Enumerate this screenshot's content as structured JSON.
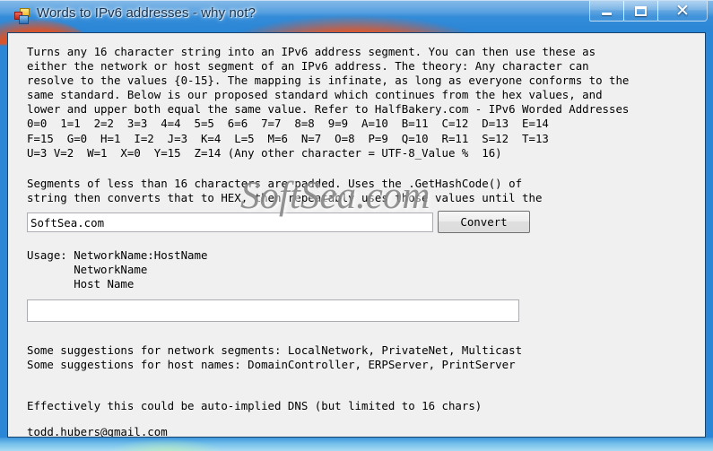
{
  "window": {
    "title": "Words to IPv6 addresses - why not?",
    "icon": "app-squares-icon",
    "controls": {
      "minimize": "Minimize",
      "maximize": "Maximize",
      "close": "Close"
    },
    "titlebar_color": "#2a86d6",
    "client_background": "#f0f0f0"
  },
  "body": {
    "intro_paragraph": "Turns any 16 character string into an IPv6 address segment. You can then use these as\neither the network or host segment of an IPv6 address. The theory: Any character can\nresolve to the values {0-15}. The mapping is infinate, as long as everyone conforms to the\nsame standard. Below is our proposed standard which continues from the hex values, and\nlower and upper both equal the same value. Refer to HalfBakery.com - IPv6 Worded Addresses\n0=0  1=1  2=2  3=3  4=4  5=5  6=6  7=7  8=8  9=9  A=10  B=11  C=12  D=13  E=14\nF=15  G=0  H=1  I=2  J=3  K=4  L=5  M=6  N=7  O=8  P=9  Q=10  R=11  S=12  T=13\nU=3 V=2  W=1  X=0  Y=15  Z=14 (Any other character = UTF-8_Value %  16)",
    "segments_paragraph": "Segments of less than 16 characters are padded. Uses the .GetHashCode() of\nstring then converts that to HEX, then repeatably uses those values until the",
    "usage_block": "Usage: NetworkName:HostName\n       NetworkName\n       Host Name",
    "suggestions_block": "Some suggestions for network segments: LocalNetwork, PrivateNet, Multicast\nSome suggestions for host names: DomainController, ERPServer, PrintServer",
    "dns_line": "Effectively this could be auto-implied DNS (but limited to 16 chars)",
    "email_line": "todd.hubers@gmail.com"
  },
  "form": {
    "input_value": "SoftSea.com",
    "input_placeholder": "",
    "output_value": "",
    "output_placeholder": "",
    "convert_label": "Convert"
  },
  "watermark": {
    "text": "SoftSea.com"
  }
}
